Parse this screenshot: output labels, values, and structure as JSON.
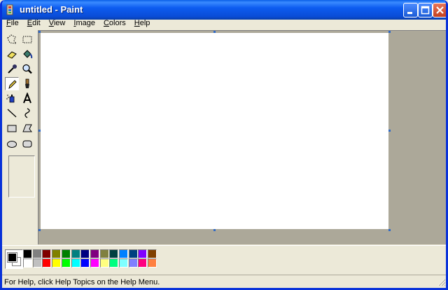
{
  "window": {
    "title": "untitled - Paint"
  },
  "menu": [
    {
      "accel": "F",
      "rest": "ile"
    },
    {
      "accel": "E",
      "rest": "dit"
    },
    {
      "accel": "V",
      "rest": "iew"
    },
    {
      "accel": "I",
      "rest": "mage"
    },
    {
      "accel": "C",
      "rest": "olors"
    },
    {
      "accel": "H",
      "rest": "elp"
    }
  ],
  "tools": [
    "free-form-select-icon",
    "rectangle-select-icon",
    "eraser-icon",
    "fill-bucket-icon",
    "pick-color-icon",
    "magnifier-icon",
    "pencil-icon",
    "brush-icon",
    "airbrush-icon",
    "text-icon",
    "line-icon",
    "curve-icon",
    "rectangle-icon",
    "polygon-icon",
    "ellipse-icon",
    "rounded-rectangle-icon"
  ],
  "active_tool": "pencil-icon",
  "colors": {
    "foreground": "#000000",
    "background": "#ffffff",
    "palette_top": [
      "#000000",
      "#808080",
      "#800000",
      "#808000",
      "#008000",
      "#008080",
      "#000080",
      "#800080",
      "#808040",
      "#004040",
      "#0080ff",
      "#004080",
      "#8000ff",
      "#804000"
    ],
    "palette_bottom": [
      "#ffffff",
      "#c0c0c0",
      "#ff0000",
      "#ffff00",
      "#00ff00",
      "#00ffff",
      "#0000ff",
      "#ff00ff",
      "#ffff80",
      "#00ff80",
      "#80ffff",
      "#8080ff",
      "#ff0080",
      "#ff8040"
    ]
  },
  "status": {
    "text": "For Help, click Help Topics on the Help Menu."
  }
}
